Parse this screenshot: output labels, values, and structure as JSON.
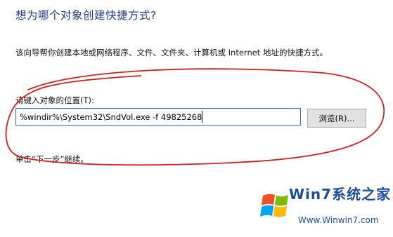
{
  "wizard": {
    "heading": "想为哪个对象创建快捷方式?",
    "description": "该向导帮你创建本地或网络程序、文件、文件夹、计算机或 Internet 地址的快捷方式。",
    "location_label": "请键入对象的位置(T):",
    "location_value": "%windir%\\System32\\SndVol.exe -f 49825268",
    "browse_label": "浏览(R)...",
    "hint": "单击“下一步”继续。"
  },
  "annotation": {
    "color": "#d11f1f"
  },
  "watermark": {
    "brand": "Win7系统之家",
    "url": "Www.Winwin7.com"
  }
}
